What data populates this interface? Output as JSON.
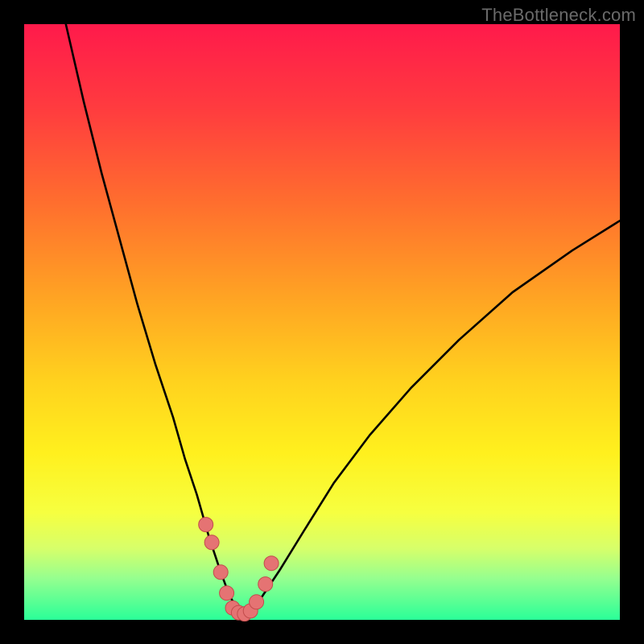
{
  "watermark": "TheBottleneck.com",
  "colors": {
    "frame": "#000000",
    "gradient_stops": [
      {
        "pct": 0,
        "color": "#ff1a4b"
      },
      {
        "pct": 14,
        "color": "#ff3b3f"
      },
      {
        "pct": 30,
        "color": "#ff6e2e"
      },
      {
        "pct": 46,
        "color": "#ffa423"
      },
      {
        "pct": 60,
        "color": "#ffd21e"
      },
      {
        "pct": 72,
        "color": "#fff01e"
      },
      {
        "pct": 82,
        "color": "#f6ff40"
      },
      {
        "pct": 88,
        "color": "#d7ff6a"
      },
      {
        "pct": 93,
        "color": "#96ff8f"
      },
      {
        "pct": 100,
        "color": "#2aff98"
      }
    ],
    "curve": "#000000",
    "marker_fill": "#e57373",
    "marker_stroke": "#c24b4b"
  },
  "chart_data": {
    "type": "line",
    "title": "",
    "xlabel": "",
    "ylabel": "",
    "xlim": [
      0,
      100
    ],
    "ylim": [
      0,
      100
    ],
    "series": [
      {
        "name": "bottleneck-curve",
        "x": [
          7,
          10,
          13,
          16,
          19,
          22,
          25,
          27,
          29,
          31,
          33,
          34.5,
          36,
          37,
          38,
          40,
          43,
          47,
          52,
          58,
          65,
          73,
          82,
          92,
          100
        ],
        "y": [
          100,
          87,
          75,
          64,
          53,
          43,
          34,
          27,
          21,
          14,
          8,
          4,
          1.5,
          0.8,
          1.5,
          4,
          8.5,
          15,
          23,
          31,
          39,
          47,
          55,
          62,
          67
        ]
      }
    ],
    "markers": {
      "name": "highlighted-points",
      "x": [
        30.5,
        31.5,
        33.0,
        34.0,
        35.0,
        36.0,
        37.0,
        38.0,
        39.0,
        40.5,
        41.5
      ],
      "y": [
        16.0,
        13.0,
        8.0,
        4.5,
        2.0,
        1.2,
        1.0,
        1.5,
        3.0,
        6.0,
        9.5
      ]
    }
  }
}
